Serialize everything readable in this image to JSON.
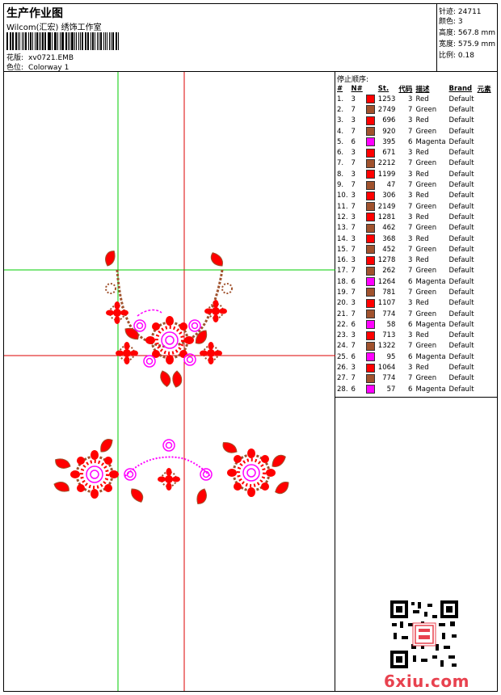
{
  "header": {
    "title": "生产作业图",
    "company": "Wilcom(汇宏) 绣饰工作室",
    "pattern_label": "花版:",
    "pattern_value": "xv0721.EMB",
    "colorway_label": "色位:",
    "colorway_value": "Colorway 1"
  },
  "stats": {
    "stitches": "针迹: 24711",
    "colors": "颜色: 3",
    "height": "高度: 567.8 mm",
    "width": "宽度: 575.9 mm",
    "scale": "比例: 0.18"
  },
  "sequence": {
    "title": "停止顺序:",
    "headers": [
      "#",
      "N#",
      "St.",
      "代码",
      "描述",
      "Brand",
      "元素"
    ],
    "rows": [
      {
        "idx": "1.",
        "n": "3",
        "color": "#ff0000",
        "st": "1253",
        "code": "3",
        "desc": "Red",
        "brand": "Default"
      },
      {
        "idx": "2.",
        "n": "7",
        "color": "#a0522d",
        "st": "2749",
        "code": "7",
        "desc": "Green",
        "brand": "Default"
      },
      {
        "idx": "3.",
        "n": "3",
        "color": "#ff0000",
        "st": "696",
        "code": "3",
        "desc": "Red",
        "brand": "Default"
      },
      {
        "idx": "4.",
        "n": "7",
        "color": "#a0522d",
        "st": "920",
        "code": "7",
        "desc": "Green",
        "brand": "Default"
      },
      {
        "idx": "5.",
        "n": "6",
        "color": "#ff00ff",
        "st": "395",
        "code": "6",
        "desc": "Magenta",
        "brand": "Default"
      },
      {
        "idx": "6.",
        "n": "3",
        "color": "#ff0000",
        "st": "671",
        "code": "3",
        "desc": "Red",
        "brand": "Default"
      },
      {
        "idx": "7.",
        "n": "7",
        "color": "#a0522d",
        "st": "2212",
        "code": "7",
        "desc": "Green",
        "brand": "Default"
      },
      {
        "idx": "8.",
        "n": "3",
        "color": "#ff0000",
        "st": "1199",
        "code": "3",
        "desc": "Red",
        "brand": "Default"
      },
      {
        "idx": "9.",
        "n": "7",
        "color": "#a0522d",
        "st": "47",
        "code": "7",
        "desc": "Green",
        "brand": "Default"
      },
      {
        "idx": "10.",
        "n": "3",
        "color": "#ff0000",
        "st": "306",
        "code": "3",
        "desc": "Red",
        "brand": "Default"
      },
      {
        "idx": "11.",
        "n": "7",
        "color": "#a0522d",
        "st": "2149",
        "code": "7",
        "desc": "Green",
        "brand": "Default"
      },
      {
        "idx": "12.",
        "n": "3",
        "color": "#ff0000",
        "st": "1281",
        "code": "3",
        "desc": "Red",
        "brand": "Default"
      },
      {
        "idx": "13.",
        "n": "7",
        "color": "#a0522d",
        "st": "462",
        "code": "7",
        "desc": "Green",
        "brand": "Default"
      },
      {
        "idx": "14.",
        "n": "3",
        "color": "#ff0000",
        "st": "368",
        "code": "3",
        "desc": "Red",
        "brand": "Default"
      },
      {
        "idx": "15.",
        "n": "7",
        "color": "#a0522d",
        "st": "452",
        "code": "7",
        "desc": "Green",
        "brand": "Default"
      },
      {
        "idx": "16.",
        "n": "3",
        "color": "#ff0000",
        "st": "1278",
        "code": "3",
        "desc": "Red",
        "brand": "Default"
      },
      {
        "idx": "17.",
        "n": "7",
        "color": "#a0522d",
        "st": "262",
        "code": "7",
        "desc": "Green",
        "brand": "Default"
      },
      {
        "idx": "18.",
        "n": "6",
        "color": "#ff00ff",
        "st": "1264",
        "code": "6",
        "desc": "Magenta",
        "brand": "Default"
      },
      {
        "idx": "19.",
        "n": "7",
        "color": "#a0522d",
        "st": "781",
        "code": "7",
        "desc": "Green",
        "brand": "Default"
      },
      {
        "idx": "20.",
        "n": "3",
        "color": "#ff0000",
        "st": "1107",
        "code": "3",
        "desc": "Red",
        "brand": "Default"
      },
      {
        "idx": "21.",
        "n": "7",
        "color": "#a0522d",
        "st": "774",
        "code": "7",
        "desc": "Green",
        "brand": "Default"
      },
      {
        "idx": "22.",
        "n": "6",
        "color": "#ff00ff",
        "st": "58",
        "code": "6",
        "desc": "Magenta",
        "brand": "Default"
      },
      {
        "idx": "23.",
        "n": "3",
        "color": "#ff0000",
        "st": "713",
        "code": "3",
        "desc": "Red",
        "brand": "Default"
      },
      {
        "idx": "24.",
        "n": "7",
        "color": "#a0522d",
        "st": "1322",
        "code": "7",
        "desc": "Green",
        "brand": "Default"
      },
      {
        "idx": "25.",
        "n": "6",
        "color": "#ff00ff",
        "st": "95",
        "code": "6",
        "desc": "Magenta",
        "brand": "Default"
      },
      {
        "idx": "26.",
        "n": "3",
        "color": "#ff0000",
        "st": "1064",
        "code": "3",
        "desc": "Red",
        "brand": "Default"
      },
      {
        "idx": "27.",
        "n": "7",
        "color": "#a0522d",
        "st": "774",
        "code": "7",
        "desc": "Green",
        "brand": "Default"
      },
      {
        "idx": "28.",
        "n": "6",
        "color": "#ff00ff",
        "st": "57",
        "code": "6",
        "desc": "Magenta",
        "brand": "Default"
      }
    ]
  },
  "footer": {
    "watermark": "6xiu.com",
    "qr_icon": "qr-code-icon"
  },
  "colors": {
    "red": "#ff0000",
    "brown": "#a0522d",
    "magenta": "#ff00ff",
    "guide_green": "#00cc00",
    "guide_red": "#dd0000",
    "logo": "#e8424f"
  }
}
